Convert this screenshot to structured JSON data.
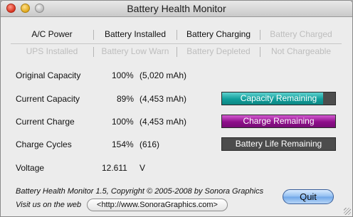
{
  "window": {
    "title": "Battery Health Monitor"
  },
  "status": {
    "row1": [
      {
        "label": "A/C Power",
        "active": true
      },
      {
        "label": "Battery Installed",
        "active": true
      },
      {
        "label": "Battery Charging",
        "active": true
      },
      {
        "label": "Battery Charged",
        "active": false
      }
    ],
    "row2": [
      {
        "label": "UPS Installed",
        "active": false
      },
      {
        "label": "Battery Low Warn",
        "active": false
      },
      {
        "label": "Battery Depleted",
        "active": false
      },
      {
        "label": "Not Chargeable",
        "active": false
      }
    ]
  },
  "stats": {
    "original_capacity": {
      "label": "Original Capacity",
      "percent": "100%",
      "detail": "(5,020 mAh)"
    },
    "current_capacity": {
      "label": "Current Capacity",
      "percent": "89%",
      "detail": "(4,453 mAh)"
    },
    "current_charge": {
      "label": "Current Charge",
      "percent": "100%",
      "detail": "(4,453 mAh)"
    },
    "charge_cycles": {
      "label": "Charge Cycles",
      "percent": "154%",
      "detail": "(616)"
    },
    "voltage": {
      "label": "Voltage",
      "value": "12.611",
      "unit": "V"
    }
  },
  "bars": {
    "capacity": {
      "label": "Capacity Remaining",
      "level": 0.89,
      "color": "#119e9b"
    },
    "charge": {
      "label": "Charge Remaining",
      "level": 1.0,
      "color": "#8d0f8a"
    },
    "life": {
      "label": "Battery Life Remaining",
      "level": 0.0,
      "color": "#4c4c4c"
    }
  },
  "footer": {
    "copyright": "Battery Health Monitor 1.5, Copyright © 2005-2008 by Sonora Graphics",
    "visit_label": "Visit us on the web",
    "url": "<http://www.SonoraGraphics.com>",
    "quit_label": "Quit"
  }
}
